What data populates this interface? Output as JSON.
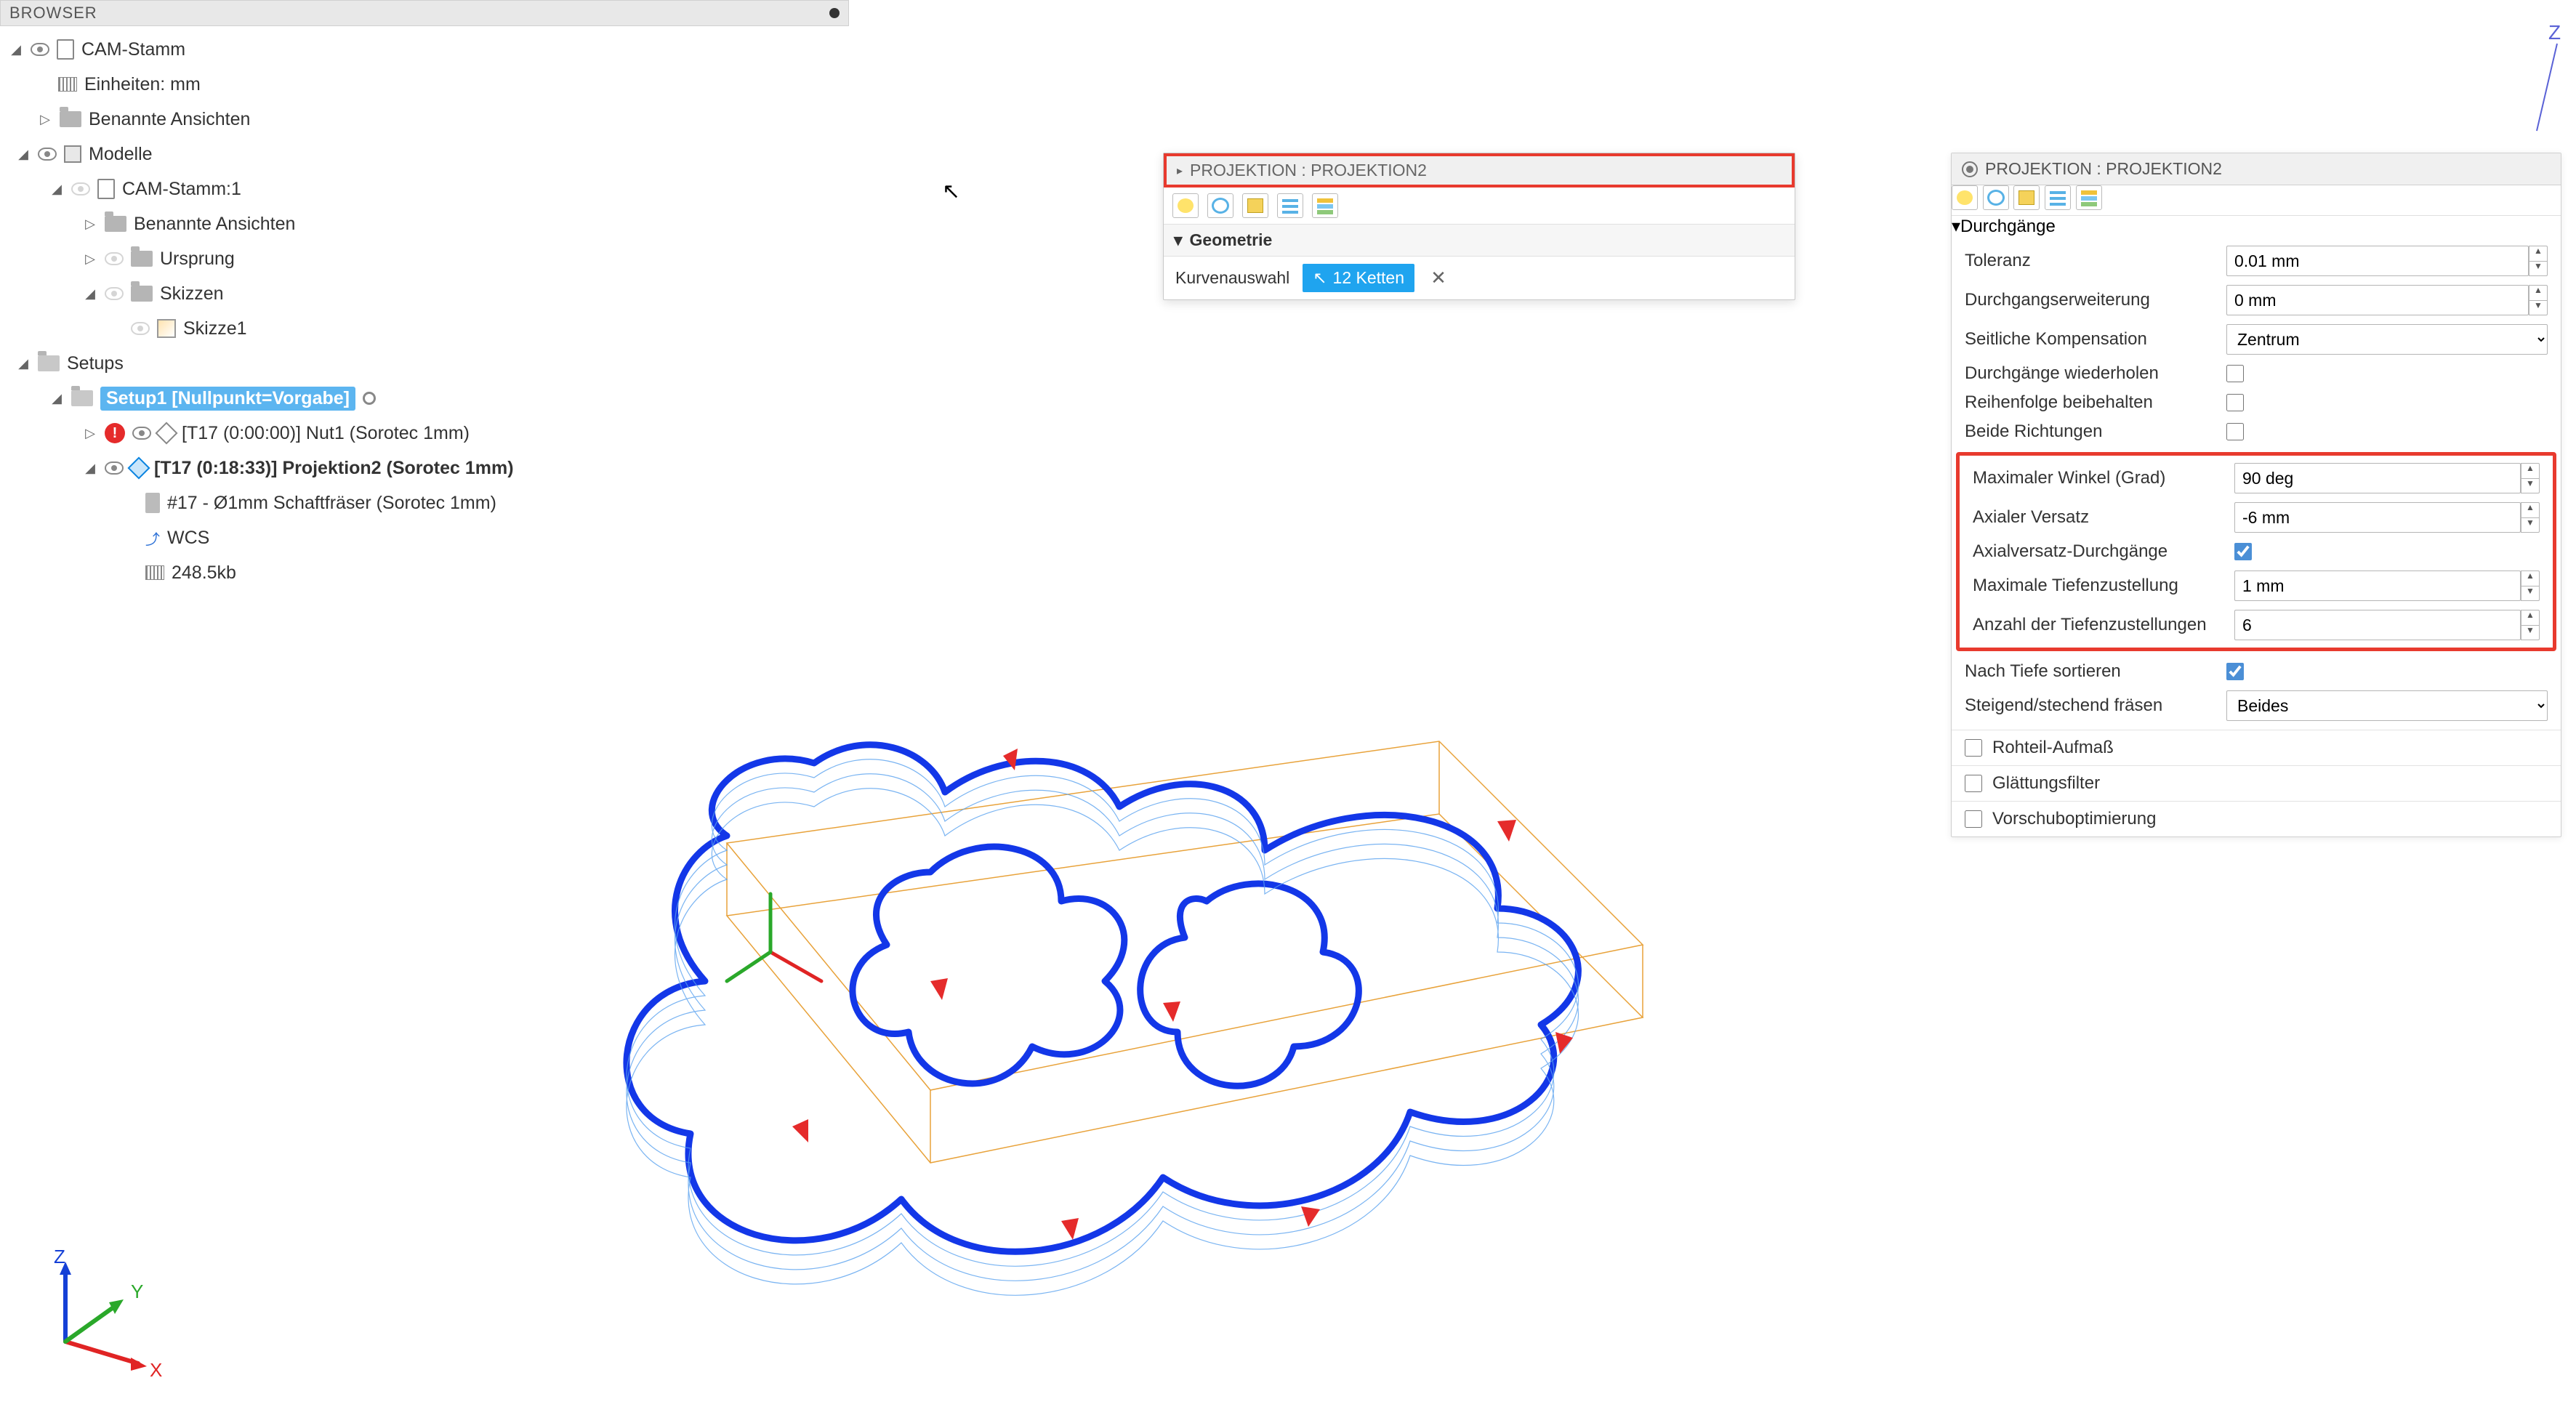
{
  "browser": {
    "title": "BROWSER",
    "tree": {
      "root": "CAM-Stamm",
      "units": "Einheiten: mm",
      "named_views": "Benannte Ansichten",
      "models": "Modelle",
      "model_child": "CAM-Stamm:1",
      "child_named_views": "Benannte Ansichten",
      "origin": "Ursprung",
      "sketches": "Skizzen",
      "sketch1": "Skizze1",
      "setups": "Setups",
      "setup1": "Setup1 [Nullpunkt=Vorgabe]",
      "op1": "[T17 (0:00:00)] Nut1 (Sorotec 1mm)",
      "op2": "[T17 (0:18:33)] Projektion2 (Sorotec 1mm)",
      "tool": "#17 - Ø1mm Schaftfräser (Sorotec 1mm)",
      "wcs": "WCS",
      "size": "248.5kb"
    }
  },
  "dialog": {
    "title": "PROJEKTION : PROJEKTION2",
    "sect_geom": "Geometrie",
    "curve_sel": "Kurvenauswahl",
    "chains": "12 Ketten"
  },
  "panel": {
    "title": "PROJEKTION : PROJEKTION2",
    "sect_passes": "Durchgänge",
    "toleranz": {
      "label": "Toleranz",
      "value": "0.01 mm"
    },
    "erw": {
      "label": "Durchgangserweiterung",
      "value": "0 mm"
    },
    "komp": {
      "label": "Seitliche Kompensation",
      "value": "Zentrum"
    },
    "wiederholen": {
      "label": "Durchgänge wiederholen",
      "value": false
    },
    "reihenfolge": {
      "label": "Reihenfolge beibehalten",
      "value": false
    },
    "richtungen": {
      "label": "Beide Richtungen",
      "value": false
    },
    "max_winkel": {
      "label": "Maximaler Winkel (Grad)",
      "value": "90 deg"
    },
    "ax_versatz": {
      "label": "Axialer Versatz",
      "value": "-6 mm"
    },
    "ax_durch": {
      "label": "Axialversatz-Durchgänge",
      "value": true
    },
    "max_tief": {
      "label": "Maximale Tiefenzustellung",
      "value": "1 mm"
    },
    "anz_tief": {
      "label": "Anzahl der Tiefenzustellungen",
      "value": "6"
    },
    "nach_tiefe": {
      "label": "Nach Tiefe sortieren",
      "value": true
    },
    "steigend": {
      "label": "Steigend/stechend fräsen",
      "value": "Beides"
    },
    "rohteil": "Rohteil-Aufmaß",
    "glatt": "Glättungsfilter",
    "vorschub": "Vorschuboptimierung"
  },
  "axes": {
    "x": "X",
    "y": "Y",
    "z": "Z"
  }
}
